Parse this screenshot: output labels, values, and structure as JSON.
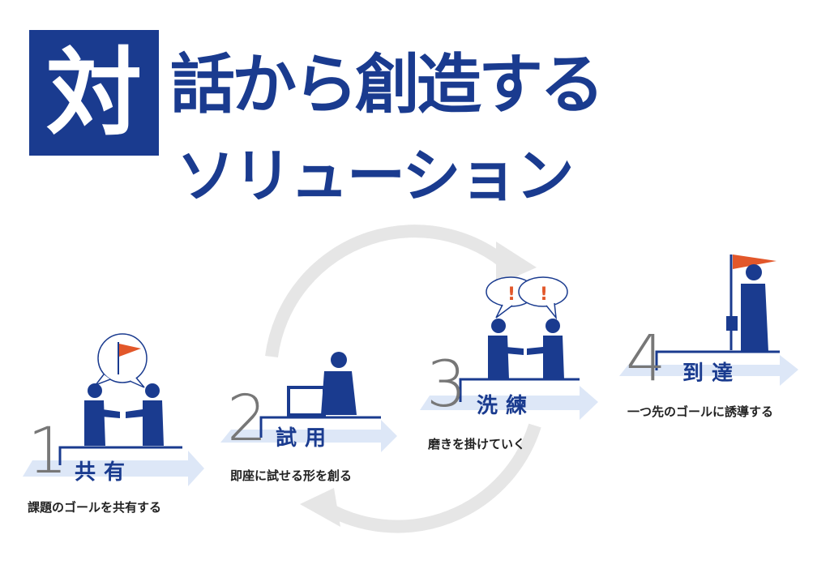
{
  "title": {
    "box_char": "対",
    "line1": "話から創造する",
    "line2": "ソリューション"
  },
  "steps": [
    {
      "number": "1",
      "label": "共有",
      "description": "課題のゴールを共有する"
    },
    {
      "number": "2",
      "label": "試用",
      "description": "即座に試せる形を創る"
    },
    {
      "number": "3",
      "label": "洗練",
      "description": "磨きを掛けていく"
    },
    {
      "number": "4",
      "label": "到達",
      "description": "一つ先のゴールに誘導する"
    }
  ],
  "bubbles": {
    "exclaim_left": "!",
    "exclaim_right": "!"
  },
  "colors": {
    "navy": "#1a3b8f",
    "flag": "#e2572a",
    "arrow_light": "#dde7f7",
    "cycle": "#e6e6e6",
    "number": "#777777"
  }
}
